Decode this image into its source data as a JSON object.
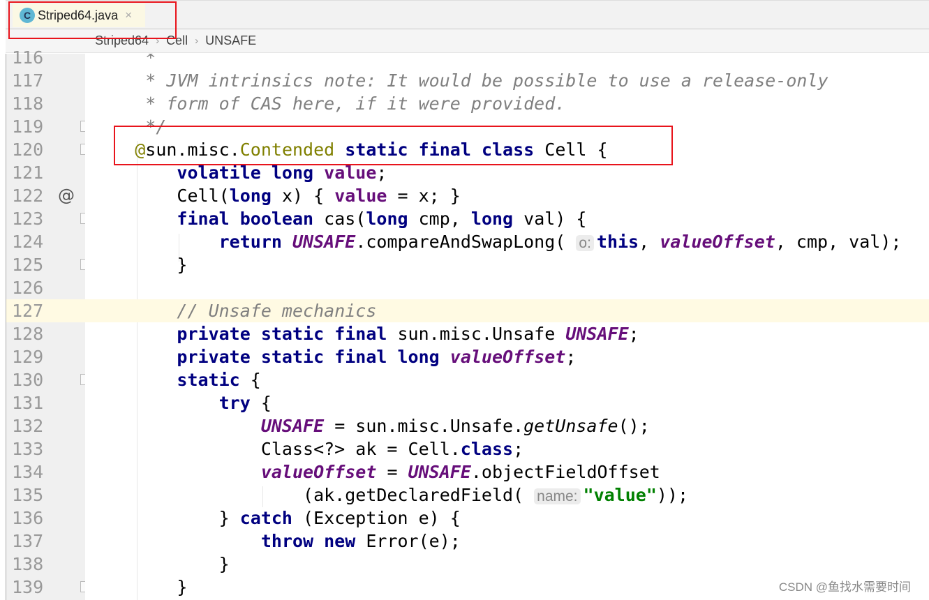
{
  "tab": {
    "icon": "java-class-icon",
    "icon_letter": "C",
    "filename": "Striped64.java",
    "close": "×"
  },
  "breadcrumb": [
    "Striped64",
    "Cell",
    "UNSAFE"
  ],
  "highlight_color": "#e8141c",
  "current_line": 127,
  "gutter_markers": {
    "fold": [
      119,
      120,
      123,
      125,
      130,
      139
    ],
    "override": {
      "line": 122,
      "glyph": "@"
    }
  },
  "lines": [
    {
      "n": 116,
      "t": [
        [
          "c",
          "     *"
        ]
      ]
    },
    {
      "n": 117,
      "t": [
        [
          "c",
          "     * JVM intrinsics note: It would be possible to use a release-only"
        ]
      ]
    },
    {
      "n": 118,
      "t": [
        [
          "c",
          "     * form of CAS here, if it were provided."
        ]
      ]
    },
    {
      "n": 119,
      "t": [
        [
          "c",
          "     */"
        ]
      ]
    },
    {
      "n": 120,
      "t": [
        [
          "t",
          "    "
        ],
        [
          "a",
          "@"
        ],
        [
          "t",
          "sun.misc."
        ],
        [
          "a",
          "Contended"
        ],
        [
          "t",
          " "
        ],
        [
          "k",
          "static final class"
        ],
        [
          "t",
          " Cell {"
        ]
      ]
    },
    {
      "n": 121,
      "t": [
        [
          "t",
          "        "
        ],
        [
          "k",
          "volatile long"
        ],
        [
          "t",
          " "
        ],
        [
          "fv",
          "value"
        ],
        [
          "t",
          ";"
        ]
      ]
    },
    {
      "n": 122,
      "t": [
        [
          "t",
          "        Cell("
        ],
        [
          "k",
          "long"
        ],
        [
          "t",
          " x) { "
        ],
        [
          "fv",
          "value"
        ],
        [
          "t",
          " = x; }"
        ]
      ]
    },
    {
      "n": 123,
      "t": [
        [
          "t",
          "        "
        ],
        [
          "k",
          "final boolean"
        ],
        [
          "t",
          " cas("
        ],
        [
          "k",
          "long"
        ],
        [
          "t",
          " cmp, "
        ],
        [
          "k",
          "long"
        ],
        [
          "t",
          " val) {"
        ]
      ]
    },
    {
      "n": 124,
      "t": [
        [
          "t",
          "            "
        ],
        [
          "k",
          "return"
        ],
        [
          "t",
          " "
        ],
        [
          "fb",
          "UNSAFE"
        ],
        [
          "t",
          ".compareAndSwapLong( "
        ],
        [
          "h",
          "o:"
        ],
        [
          "k",
          "this"
        ],
        [
          "t",
          ", "
        ],
        [
          "fb",
          "valueOffset"
        ],
        [
          "t",
          ", cmp, val);"
        ]
      ]
    },
    {
      "n": 125,
      "t": [
        [
          "t",
          "        }"
        ]
      ]
    },
    {
      "n": 126,
      "t": []
    },
    {
      "n": 127,
      "t": [
        [
          "t",
          "        "
        ],
        [
          "c",
          "// Unsafe mechanics"
        ]
      ]
    },
    {
      "n": 128,
      "t": [
        [
          "t",
          "        "
        ],
        [
          "k",
          "private static final"
        ],
        [
          "t",
          " sun.misc.Unsafe "
        ],
        [
          "fb",
          "UNSAFE"
        ],
        [
          "t",
          ";"
        ]
      ]
    },
    {
      "n": 129,
      "t": [
        [
          "t",
          "        "
        ],
        [
          "k",
          "private static final long"
        ],
        [
          "t",
          " "
        ],
        [
          "fb",
          "valueOffset"
        ],
        [
          "t",
          ";"
        ]
      ]
    },
    {
      "n": 130,
      "t": [
        [
          "t",
          "        "
        ],
        [
          "k",
          "static"
        ],
        [
          "t",
          " {"
        ]
      ]
    },
    {
      "n": 131,
      "t": [
        [
          "t",
          "            "
        ],
        [
          "k",
          "try"
        ],
        [
          "t",
          " {"
        ]
      ]
    },
    {
      "n": 132,
      "t": [
        [
          "t",
          "                "
        ],
        [
          "fb",
          "UNSAFE"
        ],
        [
          "t",
          " = sun.misc.Unsafe."
        ],
        [
          "m",
          "getUnsafe"
        ],
        [
          "t",
          "();"
        ]
      ]
    },
    {
      "n": 133,
      "t": [
        [
          "t",
          "                Class<?> ak = Cell."
        ],
        [
          "k",
          "class"
        ],
        [
          "t",
          ";"
        ]
      ]
    },
    {
      "n": 134,
      "t": [
        [
          "t",
          "                "
        ],
        [
          "fb",
          "valueOffset"
        ],
        [
          "t",
          " = "
        ],
        [
          "fb",
          "UNSAFE"
        ],
        [
          "t",
          ".objectFieldOffset"
        ]
      ]
    },
    {
      "n": 135,
      "t": [
        [
          "t",
          "                    (ak.getDeclaredField( "
        ],
        [
          "h",
          "name:"
        ],
        [
          "s",
          "\"value\""
        ],
        [
          "t",
          "));"
        ]
      ]
    },
    {
      "n": 136,
      "t": [
        [
          "t",
          "            } "
        ],
        [
          "k",
          "catch"
        ],
        [
          "t",
          " (Exception e) {"
        ]
      ]
    },
    {
      "n": 137,
      "t": [
        [
          "t",
          "                "
        ],
        [
          "k",
          "throw new"
        ],
        [
          "t",
          " Error(e);"
        ]
      ]
    },
    {
      "n": 138,
      "t": [
        [
          "t",
          "            }"
        ]
      ]
    },
    {
      "n": 139,
      "t": [
        [
          "t",
          "        }"
        ]
      ]
    }
  ],
  "watermark": "CSDN @鱼找水需要时间"
}
